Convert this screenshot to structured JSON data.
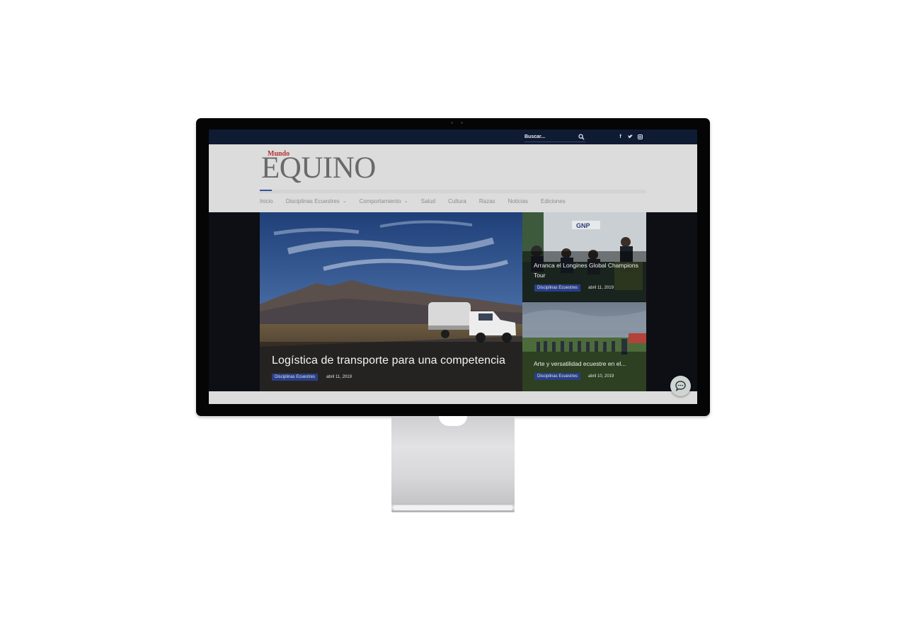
{
  "search": {
    "placeholder": "Buscar..."
  },
  "socials": [
    {
      "icon": "facebook-icon",
      "glyph": "f"
    },
    {
      "icon": "twitter-icon",
      "glyph": "t"
    },
    {
      "icon": "instagram-icon",
      "glyph": "◘"
    }
  ],
  "logo": {
    "small": "Mundo",
    "main": "EQUINO"
  },
  "nav": [
    {
      "label": "Inicio",
      "has_dropdown": false,
      "active": true
    },
    {
      "label": "Disciplinas Ecuestres",
      "has_dropdown": true,
      "active": false
    },
    {
      "label": "Comportamiento",
      "has_dropdown": true,
      "active": false
    },
    {
      "label": "Salud",
      "has_dropdown": false,
      "active": false
    },
    {
      "label": "Cultura",
      "has_dropdown": false,
      "active": false
    },
    {
      "label": "Razas",
      "has_dropdown": false,
      "active": false
    },
    {
      "label": "Noticias",
      "has_dropdown": false,
      "active": false
    },
    {
      "label": "Ediciones",
      "has_dropdown": false,
      "active": false
    }
  ],
  "featured": {
    "main": {
      "title": "Logística de transporte para una competencia",
      "category": "Disciplinas Ecuestres",
      "date": "abril 11, 2019"
    },
    "side": [
      {
        "title": "Arranca el Longines Global Champions Tour",
        "category": "Disciplinas Ecuestres",
        "date": "abril 11, 2019"
      },
      {
        "title": "Arte y versatilidad ecuestre en el...",
        "category": "Disciplinas Ecuestres",
        "date": "abril 10, 2019"
      }
    ]
  },
  "colors": {
    "topbar": "#0f1a33",
    "accent": "#35529a",
    "badge": "#2a3f86",
    "logo_small": "#b4322e"
  },
  "chat": {
    "icon": "chat-bubble-icon"
  }
}
